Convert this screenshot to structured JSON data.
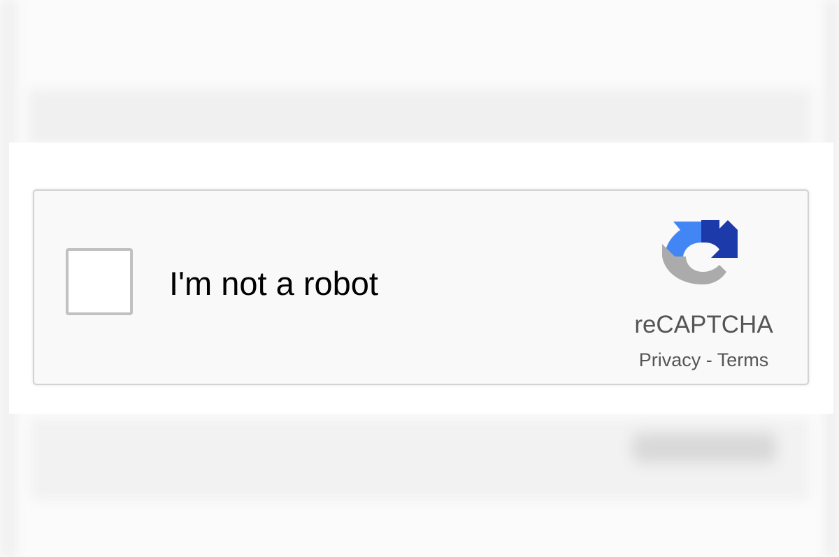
{
  "captcha": {
    "checkbox_label": "I'm not a robot",
    "checked": false,
    "brand": "reCAPTCHA",
    "privacy_link": "Privacy",
    "separator": " - ",
    "terms_link": "Terms",
    "logo_icon": "recaptcha-logo-icon"
  },
  "colors": {
    "logo_blue_dark": "#1c3aa9",
    "logo_blue_light": "#4285f4",
    "logo_gray": "#ababab",
    "text_gray": "#555555",
    "border": "#d3d3d3"
  }
}
